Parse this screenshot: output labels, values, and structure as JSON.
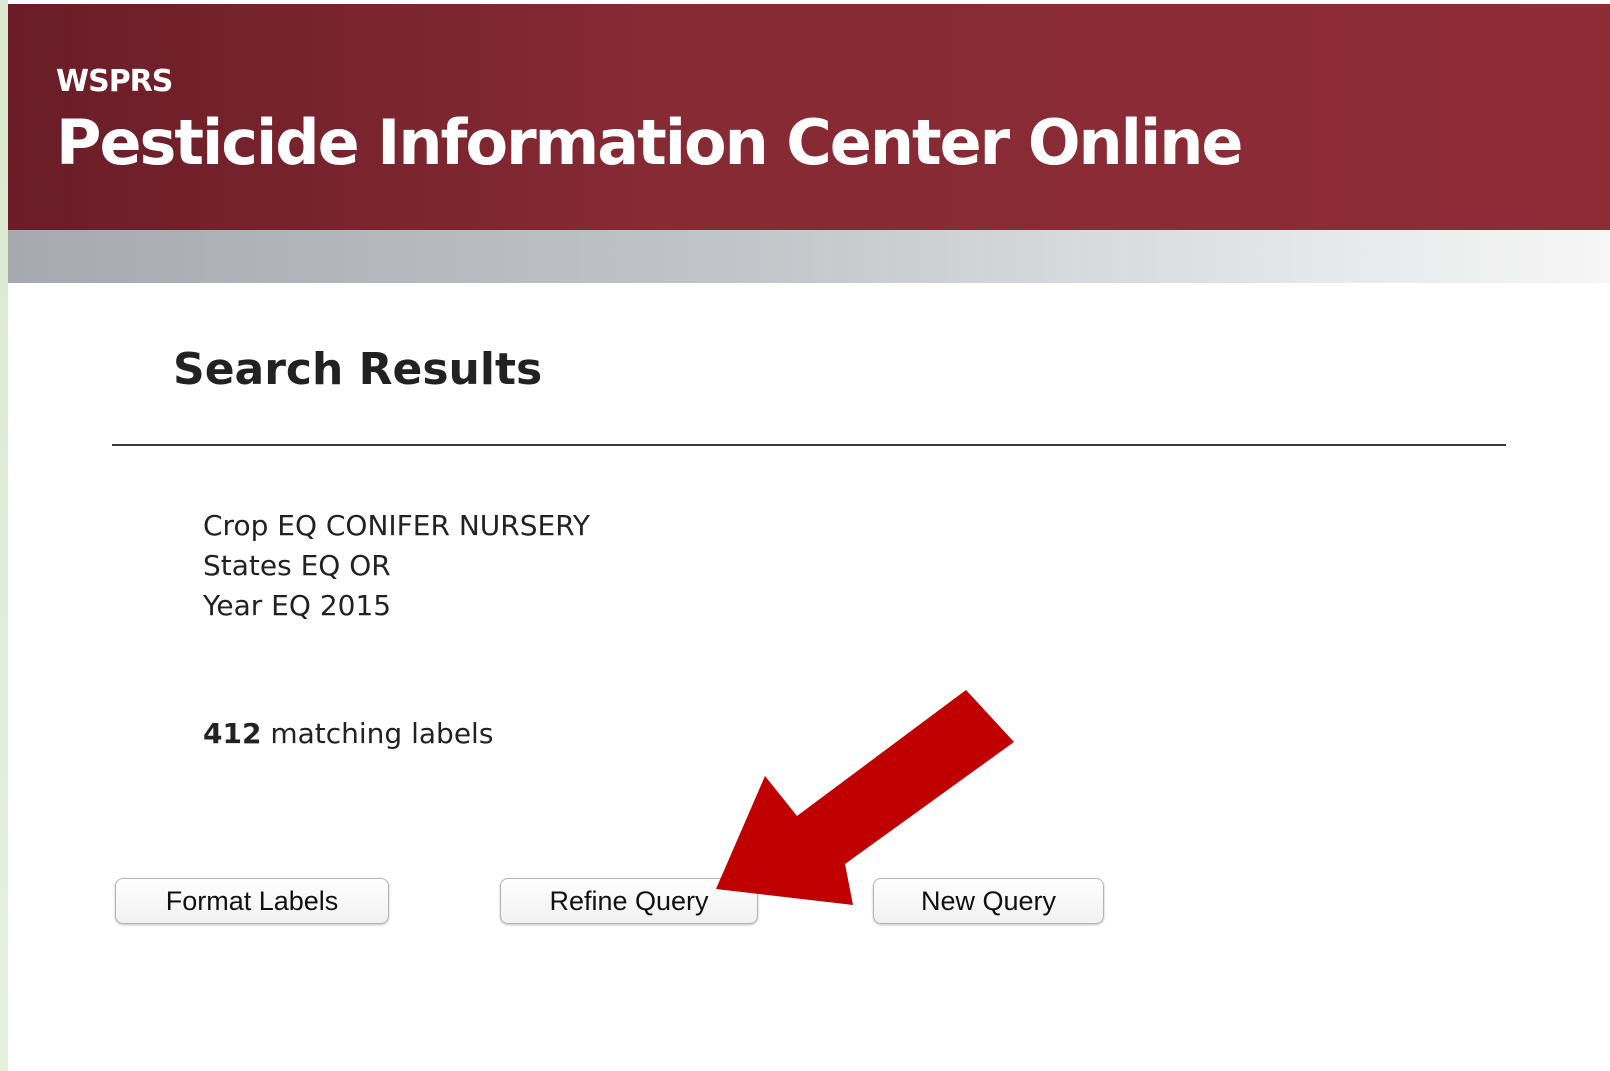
{
  "header": {
    "org": "WSPRS",
    "title": "Pesticide Information Center Online",
    "background_color": "#8e2c36"
  },
  "main": {
    "heading": "Search Results",
    "criteria": [
      "Crop EQ CONIFER NURSERY",
      "States EQ OR",
      "Year EQ 2015"
    ],
    "match_count": "412",
    "match_suffix": " matching labels"
  },
  "actions": {
    "format_label": "Format Labels",
    "refine_label": "Refine Query",
    "new_label": "New Query"
  },
  "annotation": {
    "arrow_color": "#c00000",
    "arrow_target": "refine-query-button"
  }
}
